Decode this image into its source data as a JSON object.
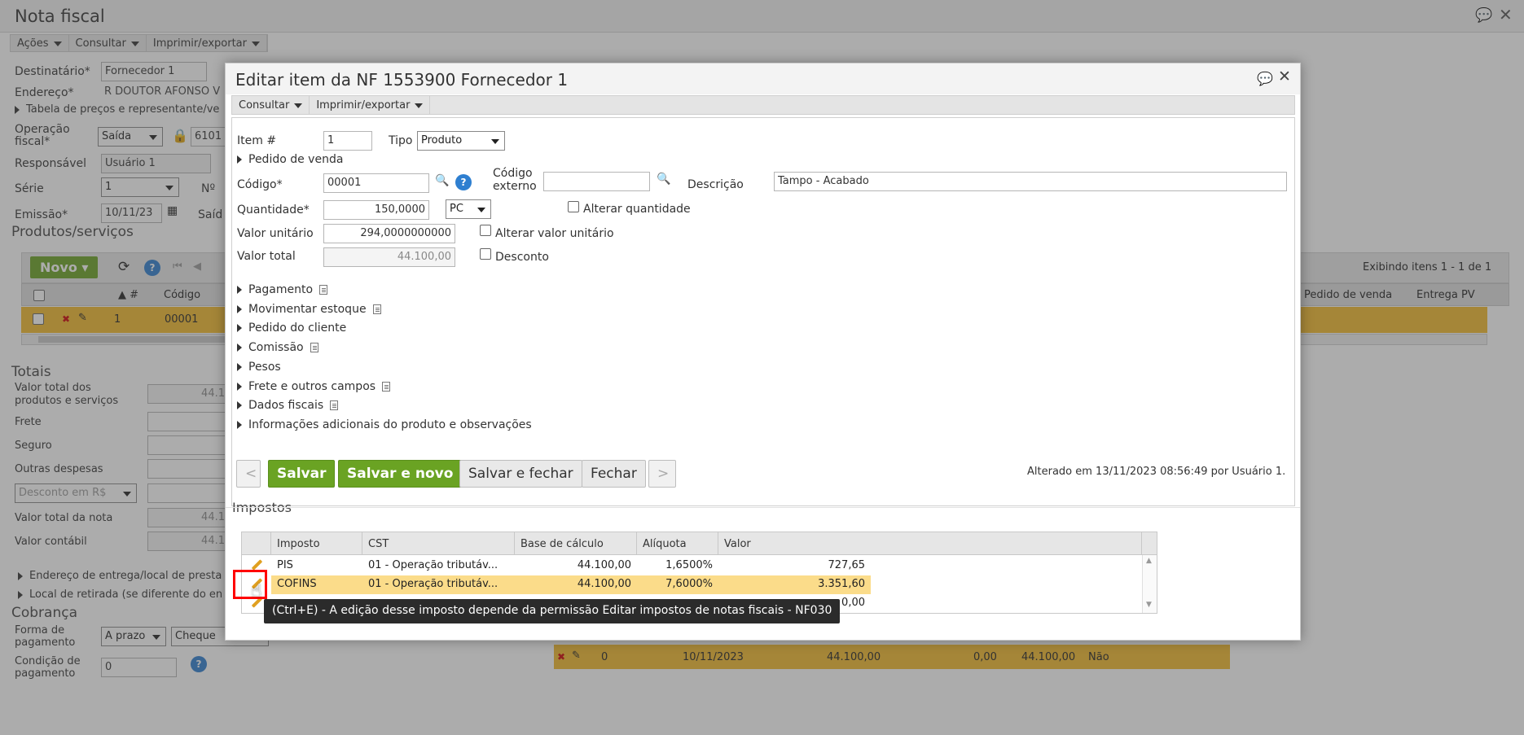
{
  "page": {
    "title": "Nota fiscal",
    "menu": [
      "Ações",
      "Consultar",
      "Imprimir/exportar"
    ]
  },
  "form": {
    "destinatario_label": "Destinatário*",
    "destinatario_value": "Fornecedor 1",
    "endereco_label": "Endereço*",
    "endereco_value": "R DOUTOR AFONSO V",
    "tabela_precos": "Tabela de preços e representante/ve",
    "operacao_label": "Operação fiscal*",
    "operacao_value": "Saída",
    "operacao_code": "6101",
    "responsavel_label": "Responsável",
    "responsavel_value": "Usuário 1",
    "serie_label": "Série",
    "serie_value": "1",
    "numero_label": "Nº",
    "emissao_label": "Emissão*",
    "emissao_value": "10/11/23",
    "saida_label": "Saíd"
  },
  "produtos": {
    "title": "Produtos/serviços",
    "novo_label": "Novo",
    "paging": "Exibindo itens 1 - 1 de 1",
    "col_num": "#",
    "col_codigo": "Código",
    "col_pedido_venda": "Pedido de venda",
    "col_entrega_pv": "Entrega PV",
    "row_num": "1",
    "row_codigo": "00001"
  },
  "totais": {
    "title": "Totais",
    "valor_total_label": "Valor total dos produtos e serviços",
    "valor_total_value": "44.1",
    "frete_label": "Frete",
    "seguro_label": "Seguro",
    "outras_label": "Outras despesas",
    "desconto_select": "Desconto em R$",
    "valor_nota_label": "Valor total da nota",
    "valor_nota_value": "44.1",
    "valor_contabil_label": "Valor contábil",
    "valor_contabil_value": "44.1",
    "endereco_entrega": "Endereço de entrega/local de presta",
    "local_retirada": "Local de retirada (se diferente do en"
  },
  "cobranca": {
    "title": "Cobrança",
    "forma_label": "Forma de pagamento",
    "forma_value": "A prazo",
    "forma_tipo": "Cheque",
    "condicao_label": "Condição de pagamento",
    "condicao_value": "0",
    "parcela": {
      "num": "0",
      "data": "10/11/2023",
      "valor": "44.100,00",
      "desc": "0,00",
      "total": "44.100,00",
      "pago": "Não"
    }
  },
  "modal": {
    "title": "Editar item da NF 1553900 Fornecedor 1",
    "menu": [
      "Consultar",
      "Imprimir/exportar"
    ],
    "item_label": "Item #",
    "item_value": "1",
    "tipo_label": "Tipo",
    "tipo_value": "Produto",
    "pedido_venda": "Pedido de venda",
    "codigo_label": "Código*",
    "codigo_value": "00001",
    "codigo_externo_label1": "Código",
    "codigo_externo_label2": "externo",
    "descricao_label": "Descrição",
    "descricao_value": "Tampo - Acabado",
    "quantidade_label": "Quantidade*",
    "quantidade_value": "150,0000",
    "unidade_value": "PC",
    "alterar_quantidade": "Alterar quantidade",
    "valor_unitario_label": "Valor unitário",
    "valor_unitario_value": "294,0000000000",
    "alterar_valor_unitario": "Alterar valor unitário",
    "valor_total_label": "Valor total",
    "valor_total_value": "44.100,00",
    "desconto": "Desconto",
    "sections": [
      "Pagamento",
      "Movimentar estoque",
      "Pedido do cliente",
      "Comissão",
      "Pesos",
      "Frete e outros campos",
      "Dados fiscais",
      "Informações adicionais do produto e observações"
    ],
    "btn_prev": "<",
    "btn_salvar": "Salvar",
    "btn_salvar_novo": "Salvar e novo",
    "btn_salvar_fechar": "Salvar e fechar",
    "btn_fechar": "Fechar",
    "btn_next": ">",
    "alterado": "Alterado em 13/11/2023 08:56:49 por Usuário 1.",
    "impostos_title": "Impostos",
    "impostos": {
      "headers": [
        "Imposto",
        "CST",
        "Base de cálculo",
        "Alíquota",
        "Valor"
      ],
      "rows": [
        {
          "imposto": "PIS",
          "cst": "01 - Operação tributáv...",
          "base": "44.100,00",
          "aliquota": "1,6500%",
          "valor": "727,65"
        },
        {
          "imposto": "COFINS",
          "cst": "01 - Operação tributáv...",
          "base": "44.100,00",
          "aliquota": "7,6000%",
          "valor": "3.351,60"
        },
        {
          "imposto": "",
          "cst": "",
          "base": "",
          "aliquota": "",
          "valor": "0,00"
        }
      ]
    },
    "tooltip": "(Ctrl+E) - A edição desse imposto depende da permissão Editar impostos de notas fiscais - NF030"
  }
}
